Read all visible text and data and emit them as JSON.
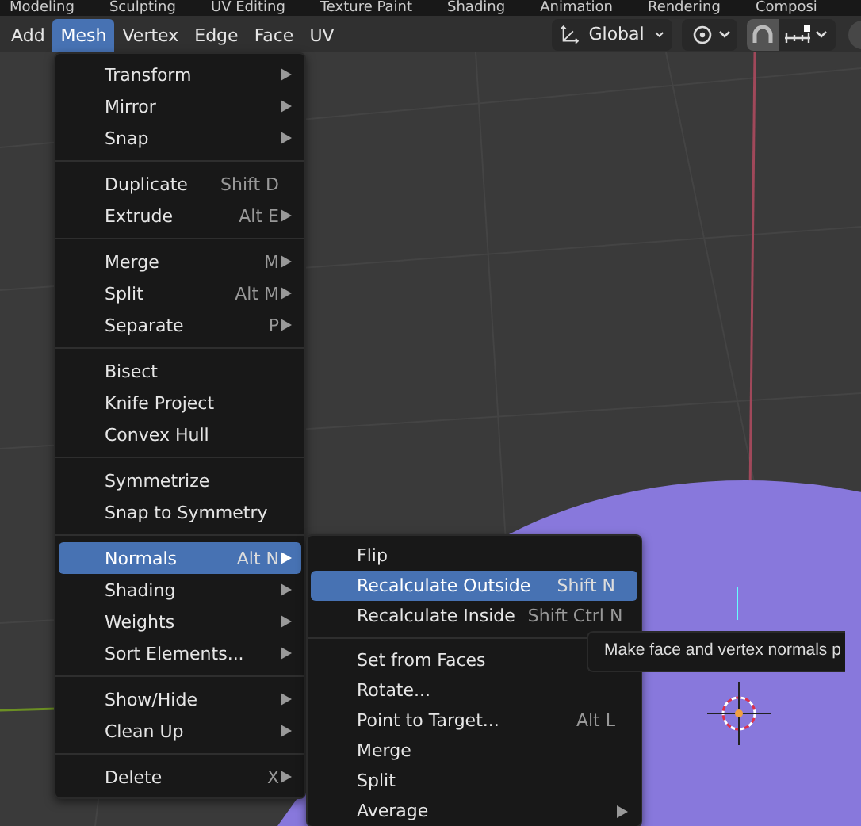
{
  "workspace_tabs": [
    "Modeling",
    "Sculpting",
    "UV Editing",
    "Texture Paint",
    "Shading",
    "Animation",
    "Rendering",
    "Composi"
  ],
  "header_menus": [
    {
      "label": "Add",
      "selected": false
    },
    {
      "label": "Mesh",
      "selected": true
    },
    {
      "label": "Vertex",
      "selected": false
    },
    {
      "label": "Edge",
      "selected": false
    },
    {
      "label": "Face",
      "selected": false
    },
    {
      "label": "UV",
      "selected": false
    }
  ],
  "orientation_dropdown": {
    "value": "Global"
  },
  "snap_toggle": {
    "on": true
  },
  "mesh_menu": {
    "groups": [
      [
        {
          "label": "Transform",
          "submenu": true,
          "selected": false
        },
        {
          "label": "Mirror",
          "submenu": true,
          "selected": false
        },
        {
          "label": "Snap",
          "submenu": true,
          "selected": false
        }
      ],
      [
        {
          "label": "Duplicate",
          "shortcut": "Shift D",
          "submenu": false,
          "selected": false
        },
        {
          "label": "Extrude",
          "shortcut": "Alt E",
          "submenu": true,
          "selected": false
        }
      ],
      [
        {
          "label": "Merge",
          "shortcut": "M",
          "submenu": true,
          "selected": false
        },
        {
          "label": "Split",
          "shortcut": "Alt M",
          "submenu": true,
          "selected": false
        },
        {
          "label": "Separate",
          "shortcut": "P",
          "submenu": true,
          "selected": false
        }
      ],
      [
        {
          "label": "Bisect",
          "submenu": false,
          "selected": false
        },
        {
          "label": "Knife Project",
          "submenu": false,
          "selected": false
        },
        {
          "label": "Convex Hull",
          "submenu": false,
          "selected": false
        }
      ],
      [
        {
          "label": "Symmetrize",
          "submenu": false,
          "selected": false
        },
        {
          "label": "Snap to Symmetry",
          "submenu": false,
          "selected": false
        }
      ],
      [
        {
          "label": "Normals",
          "shortcut": "Alt N",
          "submenu": true,
          "selected": true
        },
        {
          "label": "Shading",
          "submenu": true,
          "selected": false
        },
        {
          "label": "Weights",
          "submenu": true,
          "selected": false
        },
        {
          "label": "Sort Elements...",
          "submenu": true,
          "selected": false
        }
      ],
      [
        {
          "label": "Show/Hide",
          "submenu": true,
          "selected": false
        },
        {
          "label": "Clean Up",
          "submenu": true,
          "selected": false
        }
      ],
      [
        {
          "label": "Delete",
          "shortcut": "X",
          "submenu": true,
          "selected": false
        }
      ]
    ]
  },
  "normals_submenu": {
    "groups": [
      [
        {
          "label": "Flip",
          "submenu": false,
          "selected": false
        },
        {
          "label": "Recalculate Outside",
          "shortcut": "Shift N",
          "submenu": false,
          "selected": true
        },
        {
          "label": "Recalculate Inside",
          "shortcut": "Shift Ctrl N",
          "submenu": false,
          "selected": false
        }
      ],
      [
        {
          "label": "Set from Faces",
          "submenu": false,
          "selected": false
        },
        {
          "label": "Rotate...",
          "submenu": false,
          "selected": false
        },
        {
          "label": "Point to Target...",
          "shortcut": "Alt L",
          "submenu": false,
          "selected": false
        },
        {
          "label": "Merge",
          "submenu": false,
          "selected": false
        },
        {
          "label": "Split",
          "submenu": false,
          "selected": false
        },
        {
          "label": "Average",
          "submenu": true,
          "selected": false
        }
      ]
    ]
  },
  "tooltip": {
    "text": "Make face and vertex normals p"
  }
}
